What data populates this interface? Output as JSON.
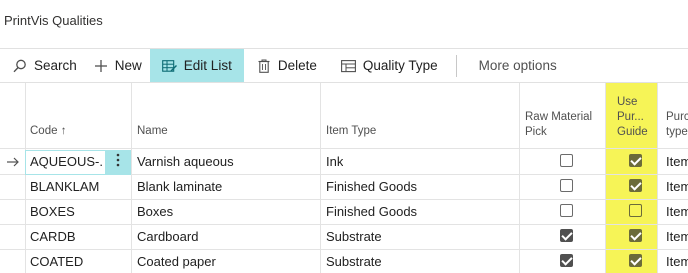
{
  "page": {
    "title": "PrintVis Qualities"
  },
  "toolbar": {
    "search_label": "Search",
    "new_label": "New",
    "edit_list_label": "Edit List",
    "delete_label": "Delete",
    "quality_type_label": "Quality Type",
    "more_options_label": "More options"
  },
  "columns": {
    "code": "Code",
    "code_sort": "↑",
    "name": "Name",
    "item_type": "Item Type",
    "raw_material_pick_1": "Raw Material",
    "raw_material_pick_2": "Pick",
    "use_pur_guide_1": "Use",
    "use_pur_guide_2": "Pur...",
    "use_pur_guide_3": "Guide",
    "purch_type_1": "Purch",
    "purch_type_2": "type"
  },
  "rows": [
    {
      "code": "AQUEOUS-...",
      "name": "Varnish aqueous",
      "item_type": "Ink",
      "raw_material_pick": false,
      "use_pur_guide": true,
      "purch_type": "Item"
    },
    {
      "code": "BLANKLAM",
      "name": "Blank laminate",
      "item_type": "Finished Goods",
      "raw_material_pick": false,
      "use_pur_guide": true,
      "purch_type": "Item"
    },
    {
      "code": "BOXES",
      "name": "Boxes",
      "item_type": "Finished Goods",
      "raw_material_pick": false,
      "use_pur_guide": false,
      "purch_type": "Item"
    },
    {
      "code": "CARDB",
      "name": "Cardboard",
      "item_type": "Substrate",
      "raw_material_pick": true,
      "use_pur_guide": true,
      "purch_type": "Item"
    },
    {
      "code": "COATED",
      "name": "Coated paper",
      "item_type": "Substrate",
      "raw_material_pick": true,
      "use_pur_guide": true,
      "purch_type": "Item"
    }
  ],
  "colors": {
    "accent": "#a7e4e8",
    "highlight": "#f4f23a"
  },
  "icons": {
    "row_marker": "arrow-right-icon",
    "row_menu": "more-vertical-icon"
  }
}
